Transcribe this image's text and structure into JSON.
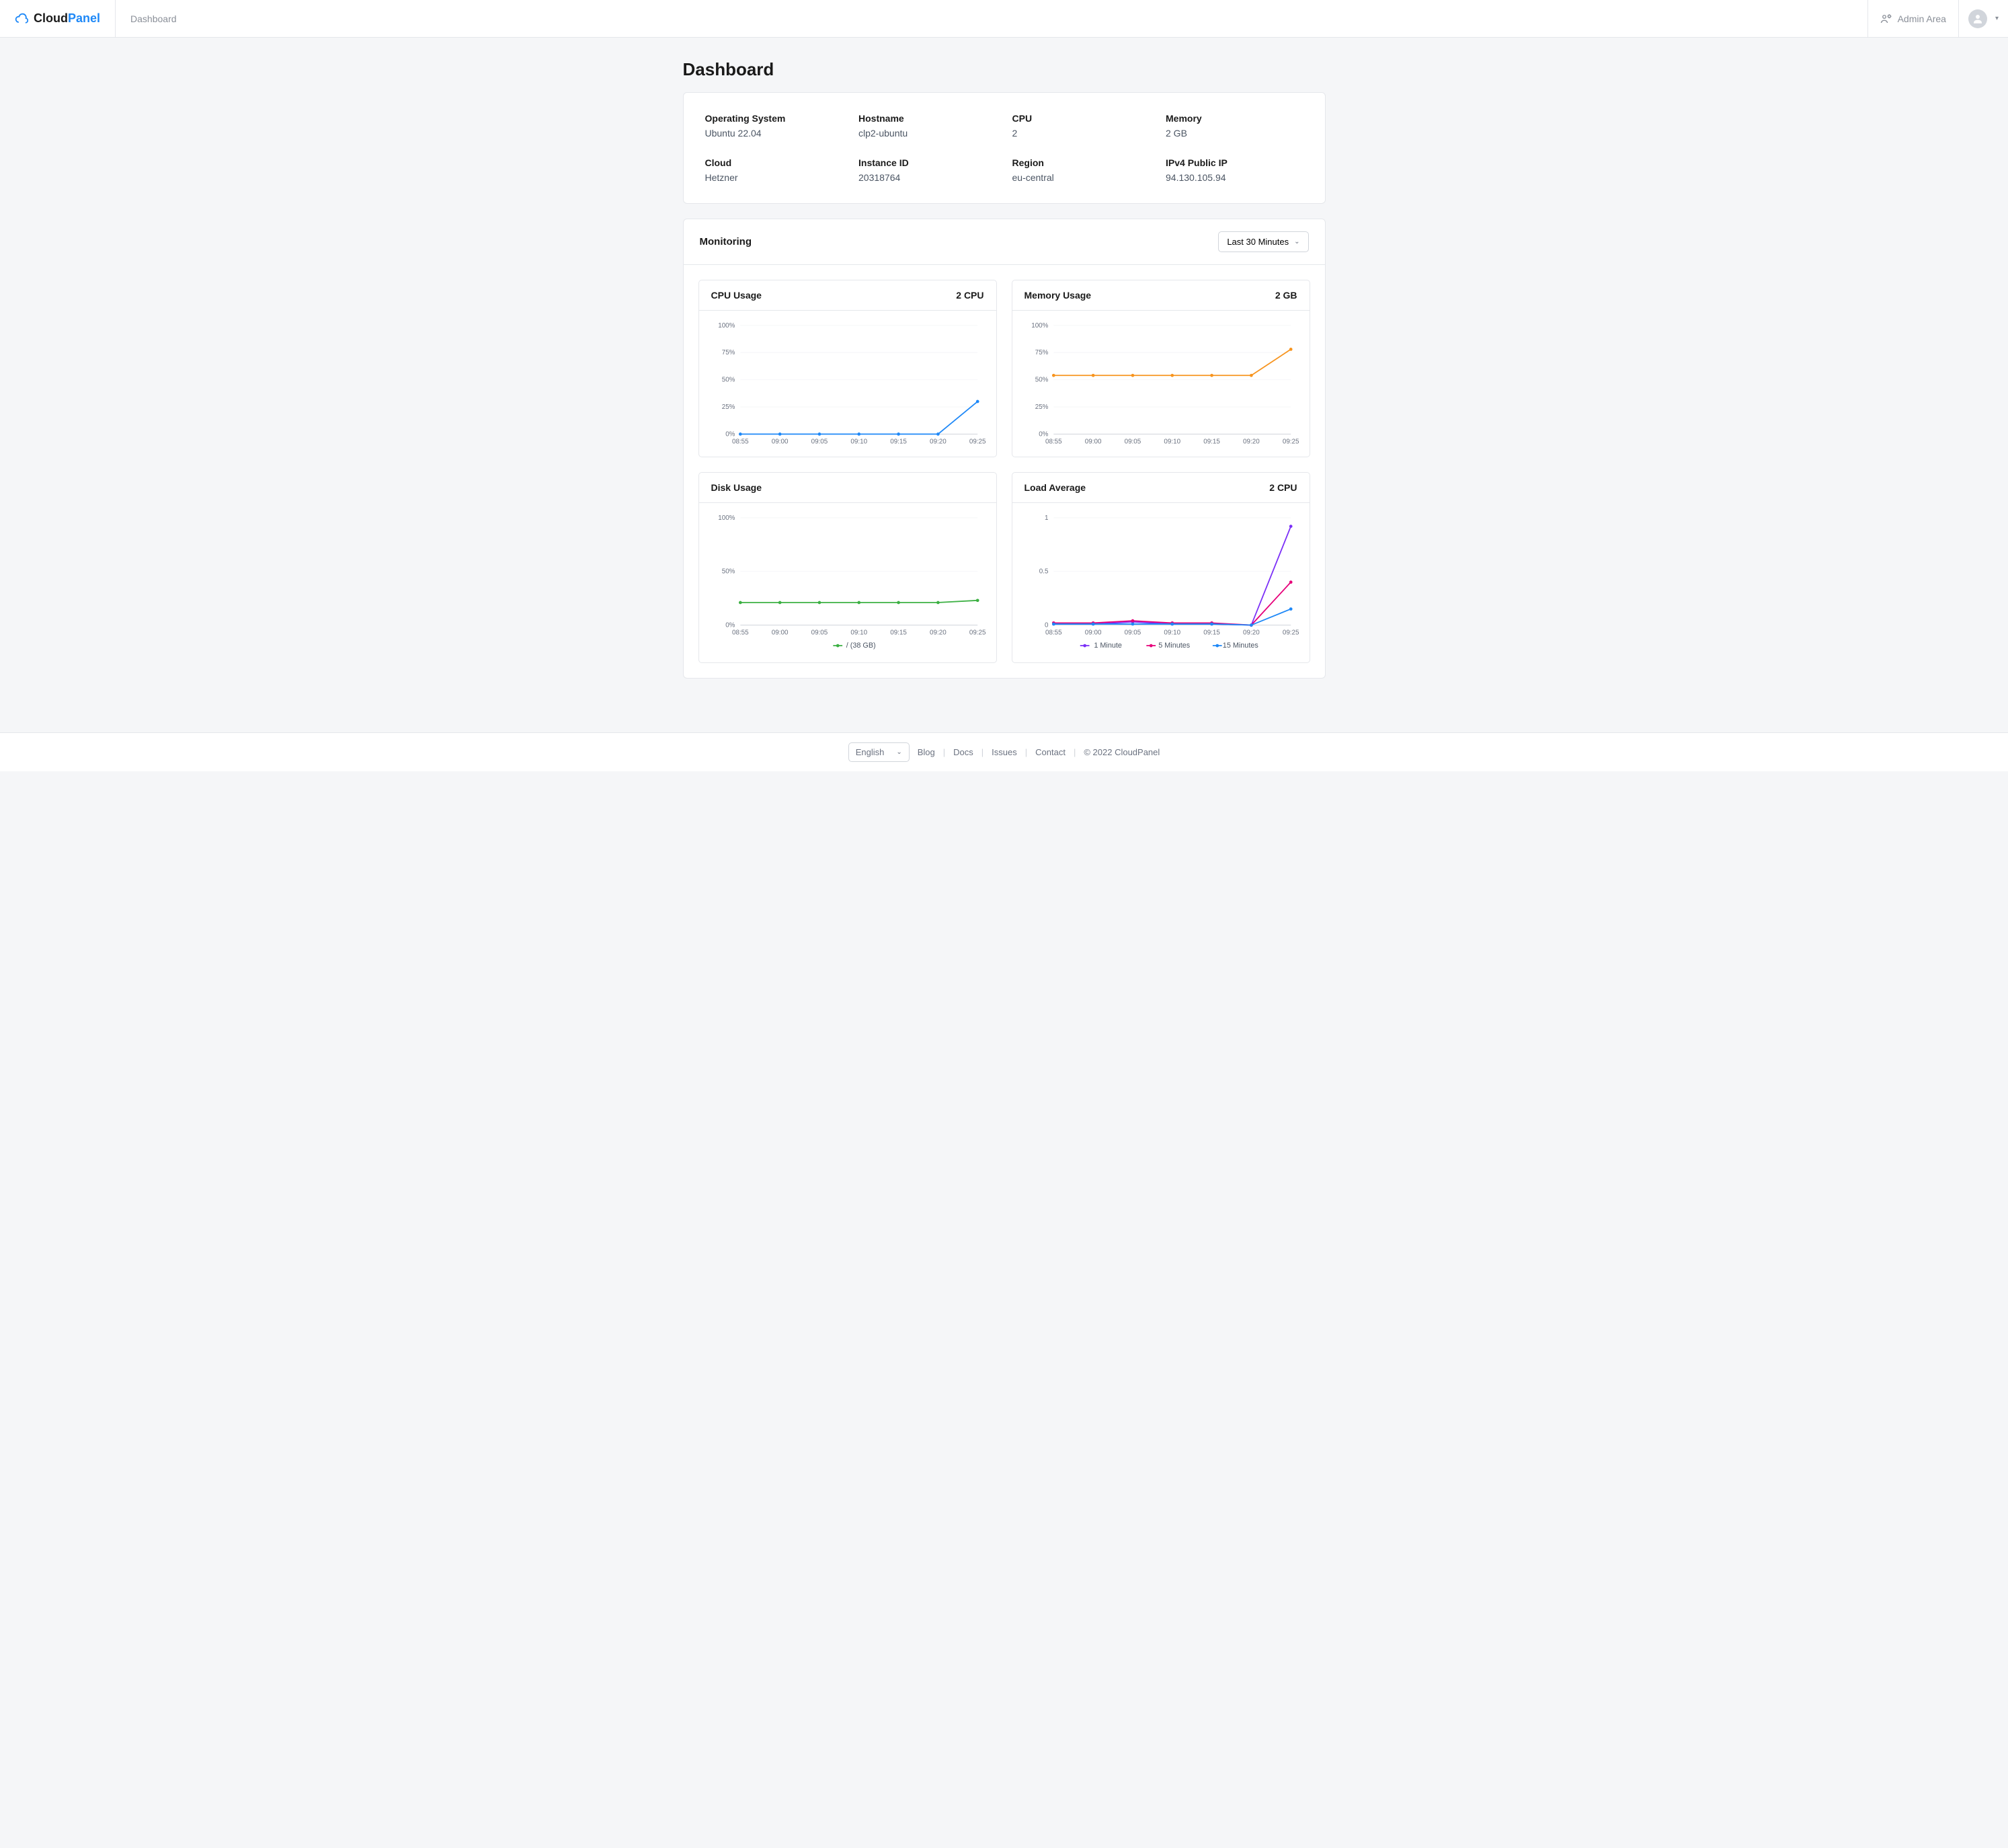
{
  "brand": {
    "cloud": "Cloud",
    "panel": "Panel"
  },
  "topnav": {
    "dashboard": "Dashboard"
  },
  "admin_area": "Admin Area",
  "page_title": "Dashboard",
  "info": {
    "os_label": "Operating System",
    "os_value": "Ubuntu 22.04",
    "hostname_label": "Hostname",
    "hostname_value": "clp2-ubuntu",
    "cpu_label": "CPU",
    "cpu_value": "2",
    "memory_label": "Memory",
    "memory_value": "2 GB",
    "cloud_label": "Cloud",
    "cloud_value": "Hetzner",
    "instance_label": "Instance ID",
    "instance_value": "20318764",
    "region_label": "Region",
    "region_value": "eu-central",
    "ip_label": "IPv4 Public IP",
    "ip_value": "94.130.105.94"
  },
  "monitoring": {
    "title": "Monitoring",
    "range": "Last 30 Minutes"
  },
  "charts": {
    "cpu": {
      "title": "CPU Usage",
      "right": "2 CPU"
    },
    "memory": {
      "title": "Memory Usage",
      "right": "2 GB"
    },
    "disk": {
      "title": "Disk Usage",
      "right": "",
      "legend": "/ (38 GB)"
    },
    "load": {
      "title": "Load Average",
      "right": "2 CPU",
      "legend1": "1 Minute",
      "legend5": "5 Minutes",
      "legend15": "15 Minutes"
    }
  },
  "footer": {
    "lang": "English",
    "blog": "Blog",
    "docs": "Docs",
    "issues": "Issues",
    "contact": "Contact",
    "copyright": "© 2022  CloudPanel"
  },
  "chart_data": [
    {
      "id": "cpu",
      "type": "line",
      "title": "CPU Usage",
      "categories": [
        "08:55",
        "09:00",
        "09:05",
        "09:10",
        "09:15",
        "09:20",
        "09:25"
      ],
      "series": [
        {
          "name": "CPU",
          "color": "#1e88f7",
          "values": [
            0,
            0,
            0,
            0,
            0,
            0,
            30
          ]
        }
      ],
      "yticks": [
        "0%",
        "25%",
        "50%",
        "75%",
        "100%"
      ],
      "ylim": [
        0,
        100
      ]
    },
    {
      "id": "memory",
      "type": "line",
      "title": "Memory Usage",
      "categories": [
        "08:55",
        "09:00",
        "09:05",
        "09:10",
        "09:15",
        "09:20",
        "09:25"
      ],
      "series": [
        {
          "name": "Memory",
          "color": "#f7941e",
          "values": [
            54,
            54,
            54,
            54,
            54,
            54,
            78
          ]
        }
      ],
      "yticks": [
        "0%",
        "25%",
        "50%",
        "75%",
        "100%"
      ],
      "ylim": [
        0,
        100
      ]
    },
    {
      "id": "disk",
      "type": "line",
      "title": "Disk Usage",
      "categories": [
        "08:55",
        "09:00",
        "09:05",
        "09:10",
        "09:15",
        "09:20",
        "09:25"
      ],
      "series": [
        {
          "name": "/ (38 GB)",
          "color": "#3cb043",
          "values": [
            21,
            21,
            21,
            21,
            21,
            21,
            23
          ]
        }
      ],
      "yticks": [
        "0%",
        "50%",
        "100%"
      ],
      "ylim": [
        0,
        100
      ],
      "legend": [
        {
          "name": "/ (38 GB)",
          "color": "#3cb043"
        }
      ]
    },
    {
      "id": "load",
      "type": "line",
      "title": "Load Average",
      "categories": [
        "08:55",
        "09:00",
        "09:05",
        "09:10",
        "09:15",
        "09:20",
        "09:25"
      ],
      "series": [
        {
          "name": "1 Minute",
          "color": "#7b2ff7",
          "values": [
            0.01,
            0.01,
            0.03,
            0.01,
            0.01,
            0.0,
            0.92
          ]
        },
        {
          "name": "5 Minutes",
          "color": "#e6007a",
          "values": [
            0.02,
            0.02,
            0.04,
            0.02,
            0.02,
            0.0,
            0.4
          ]
        },
        {
          "name": "15 Minutes",
          "color": "#1e88f7",
          "values": [
            0.01,
            0.01,
            0.01,
            0.01,
            0.01,
            0.0,
            0.15
          ]
        }
      ],
      "yticks": [
        "0",
        "0.5",
        "1"
      ],
      "ylim": [
        0,
        1
      ],
      "legend": [
        {
          "name": "1 Minute",
          "color": "#7b2ff7"
        },
        {
          "name": "5 Minutes",
          "color": "#e6007a"
        },
        {
          "name": "15 Minutes",
          "color": "#1e88f7"
        }
      ]
    }
  ]
}
